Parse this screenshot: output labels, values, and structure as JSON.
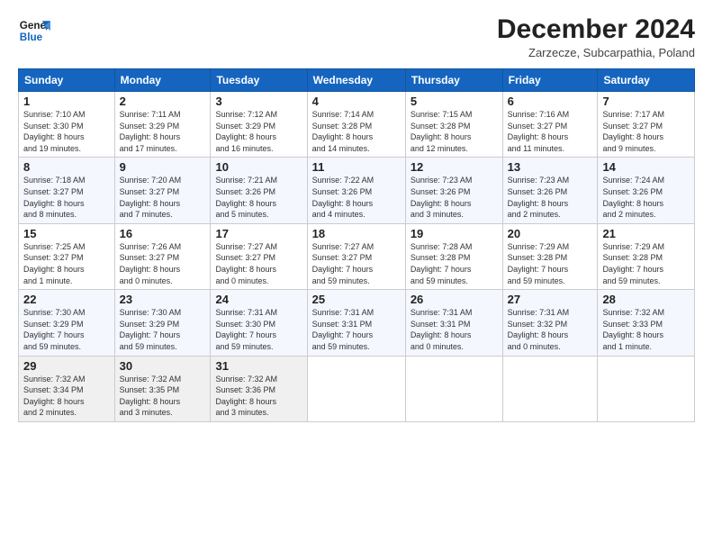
{
  "header": {
    "logo_line1": "General",
    "logo_line2": "Blue",
    "title": "December 2024",
    "location": "Zarzecze, Subcarpathia, Poland"
  },
  "days_of_week": [
    "Sunday",
    "Monday",
    "Tuesday",
    "Wednesday",
    "Thursday",
    "Friday",
    "Saturday"
  ],
  "weeks": [
    [
      {
        "day": "1",
        "sunrise": "7:10 AM",
        "sunset": "3:30 PM",
        "daylight": "8 hours and 19 minutes."
      },
      {
        "day": "2",
        "sunrise": "7:11 AM",
        "sunset": "3:29 PM",
        "daylight": "8 hours and 17 minutes."
      },
      {
        "day": "3",
        "sunrise": "7:12 AM",
        "sunset": "3:29 PM",
        "daylight": "8 hours and 16 minutes."
      },
      {
        "day": "4",
        "sunrise": "7:14 AM",
        "sunset": "3:28 PM",
        "daylight": "8 hours and 14 minutes."
      },
      {
        "day": "5",
        "sunrise": "7:15 AM",
        "sunset": "3:28 PM",
        "daylight": "8 hours and 12 minutes."
      },
      {
        "day": "6",
        "sunrise": "7:16 AM",
        "sunset": "3:27 PM",
        "daylight": "8 hours and 11 minutes."
      },
      {
        "day": "7",
        "sunrise": "7:17 AM",
        "sunset": "3:27 PM",
        "daylight": "8 hours and 9 minutes."
      }
    ],
    [
      {
        "day": "8",
        "sunrise": "7:18 AM",
        "sunset": "3:27 PM",
        "daylight": "8 hours and 8 minutes."
      },
      {
        "day": "9",
        "sunrise": "7:20 AM",
        "sunset": "3:27 PM",
        "daylight": "8 hours and 7 minutes."
      },
      {
        "day": "10",
        "sunrise": "7:21 AM",
        "sunset": "3:26 PM",
        "daylight": "8 hours and 5 minutes."
      },
      {
        "day": "11",
        "sunrise": "7:22 AM",
        "sunset": "3:26 PM",
        "daylight": "8 hours and 4 minutes."
      },
      {
        "day": "12",
        "sunrise": "7:23 AM",
        "sunset": "3:26 PM",
        "daylight": "8 hours and 3 minutes."
      },
      {
        "day": "13",
        "sunrise": "7:23 AM",
        "sunset": "3:26 PM",
        "daylight": "8 hours and 2 minutes."
      },
      {
        "day": "14",
        "sunrise": "7:24 AM",
        "sunset": "3:26 PM",
        "daylight": "8 hours and 2 minutes."
      }
    ],
    [
      {
        "day": "15",
        "sunrise": "7:25 AM",
        "sunset": "3:27 PM",
        "daylight": "8 hours and 1 minute."
      },
      {
        "day": "16",
        "sunrise": "7:26 AM",
        "sunset": "3:27 PM",
        "daylight": "8 hours and 0 minutes."
      },
      {
        "day": "17",
        "sunrise": "7:27 AM",
        "sunset": "3:27 PM",
        "daylight": "8 hours and 0 minutes."
      },
      {
        "day": "18",
        "sunrise": "7:27 AM",
        "sunset": "3:27 PM",
        "daylight": "7 hours and 59 minutes."
      },
      {
        "day": "19",
        "sunrise": "7:28 AM",
        "sunset": "3:28 PM",
        "daylight": "7 hours and 59 minutes."
      },
      {
        "day": "20",
        "sunrise": "7:29 AM",
        "sunset": "3:28 PM",
        "daylight": "7 hours and 59 minutes."
      },
      {
        "day": "21",
        "sunrise": "7:29 AM",
        "sunset": "3:28 PM",
        "daylight": "7 hours and 59 minutes."
      }
    ],
    [
      {
        "day": "22",
        "sunrise": "7:30 AM",
        "sunset": "3:29 PM",
        "daylight": "7 hours and 59 minutes."
      },
      {
        "day": "23",
        "sunrise": "7:30 AM",
        "sunset": "3:29 PM",
        "daylight": "7 hours and 59 minutes."
      },
      {
        "day": "24",
        "sunrise": "7:31 AM",
        "sunset": "3:30 PM",
        "daylight": "7 hours and 59 minutes."
      },
      {
        "day": "25",
        "sunrise": "7:31 AM",
        "sunset": "3:31 PM",
        "daylight": "7 hours and 59 minutes."
      },
      {
        "day": "26",
        "sunrise": "7:31 AM",
        "sunset": "3:31 PM",
        "daylight": "8 hours and 0 minutes."
      },
      {
        "day": "27",
        "sunrise": "7:31 AM",
        "sunset": "3:32 PM",
        "daylight": "8 hours and 0 minutes."
      },
      {
        "day": "28",
        "sunrise": "7:32 AM",
        "sunset": "3:33 PM",
        "daylight": "8 hours and 1 minute."
      }
    ],
    [
      {
        "day": "29",
        "sunrise": "7:32 AM",
        "sunset": "3:34 PM",
        "daylight": "8 hours and 2 minutes."
      },
      {
        "day": "30",
        "sunrise": "7:32 AM",
        "sunset": "3:35 PM",
        "daylight": "8 hours and 3 minutes."
      },
      {
        "day": "31",
        "sunrise": "7:32 AM",
        "sunset": "3:36 PM",
        "daylight": "8 hours and 3 minutes."
      },
      null,
      null,
      null,
      null
    ]
  ]
}
